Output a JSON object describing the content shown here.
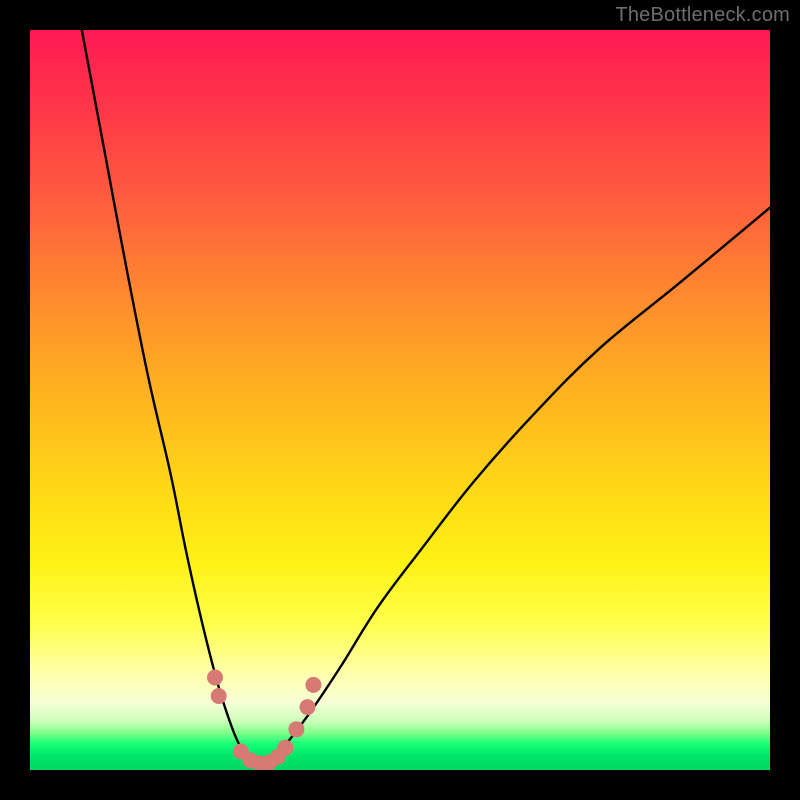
{
  "watermark": "TheBottleneck.com",
  "colors": {
    "frame": "#000000",
    "curve": "#000000",
    "marker": "#d77a74",
    "gradient_stops": [
      "#ff1a55",
      "#ff2f4b",
      "#ff5a3f",
      "#ff8a2f",
      "#ffb51f",
      "#ffd817",
      "#fff215",
      "#ffff4a",
      "#ffffad",
      "#f6ffd6",
      "#c9ffb8",
      "#7dff88",
      "#17ff76",
      "#00e66b",
      "#00d864"
    ]
  },
  "chart_data": {
    "type": "line",
    "title": "",
    "xlabel": "",
    "ylabel": "",
    "xlim": [
      0,
      100
    ],
    "ylim": [
      0,
      100
    ],
    "note": "Bottleneck-style V curve. x ≈ relative hardware balance; y ≈ bottleneck %. Minimum near x≈30. Left branch rises steeply off top edge by x≈7; right branch reaches ~76% at x=100.",
    "series": [
      {
        "name": "left_branch",
        "x": [
          7,
          10,
          13,
          16,
          19,
          21,
          23,
          25,
          26.5,
          28,
          29.5
        ],
        "y": [
          100,
          84,
          68,
          53,
          40,
          30,
          21,
          13,
          8,
          4,
          1.5
        ]
      },
      {
        "name": "right_branch",
        "x": [
          33,
          35,
          38,
          42,
          47,
          53,
          60,
          68,
          77,
          88,
          100
        ],
        "y": [
          1.5,
          4,
          8,
          14,
          22,
          30,
          39,
          48,
          57,
          66,
          76
        ]
      },
      {
        "name": "valley_floor",
        "x": [
          29.5,
          30.5,
          31.5,
          32.5,
          33
        ],
        "y": [
          1.5,
          0.8,
          0.6,
          0.8,
          1.5
        ]
      }
    ],
    "markers": {
      "name": "highlighted_points",
      "color": "#d77a74",
      "radius_px": 8,
      "points": [
        {
          "x": 25.0,
          "y": 12.5
        },
        {
          "x": 25.5,
          "y": 10.0
        },
        {
          "x": 28.5,
          "y": 2.5
        },
        {
          "x": 29.8,
          "y": 1.3
        },
        {
          "x": 31.0,
          "y": 0.9
        },
        {
          "x": 32.3,
          "y": 1.0
        },
        {
          "x": 33.5,
          "y": 1.8
        },
        {
          "x": 34.5,
          "y": 3.0
        },
        {
          "x": 36.0,
          "y": 5.5
        },
        {
          "x": 37.5,
          "y": 8.5
        },
        {
          "x": 38.3,
          "y": 11.5
        }
      ]
    }
  }
}
